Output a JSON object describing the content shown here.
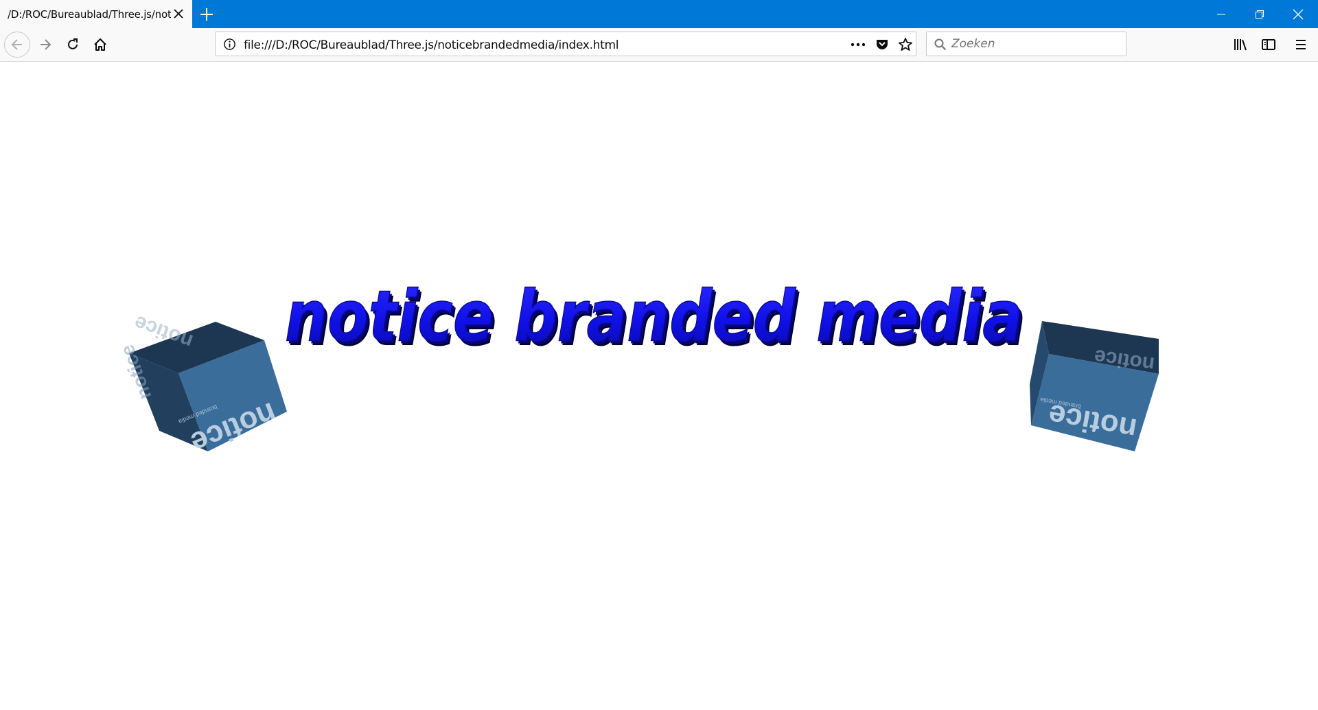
{
  "browser": {
    "tab": {
      "title": "/D:/ROC/Bureaublad/Three.js/notic"
    },
    "address": {
      "url": "file:///D:/ROC/Bureaublad/Three.js/noticebrandedmedia/index.html"
    },
    "search": {
      "placeholder": "Zoeken"
    },
    "accent_color": "#0078d7"
  },
  "scene": {
    "headline": "notice branded media",
    "headline_color": "#1010e8",
    "cube_brand": "notice",
    "cube_tagline": "branded media",
    "cube_color": "#2e5f8a"
  }
}
